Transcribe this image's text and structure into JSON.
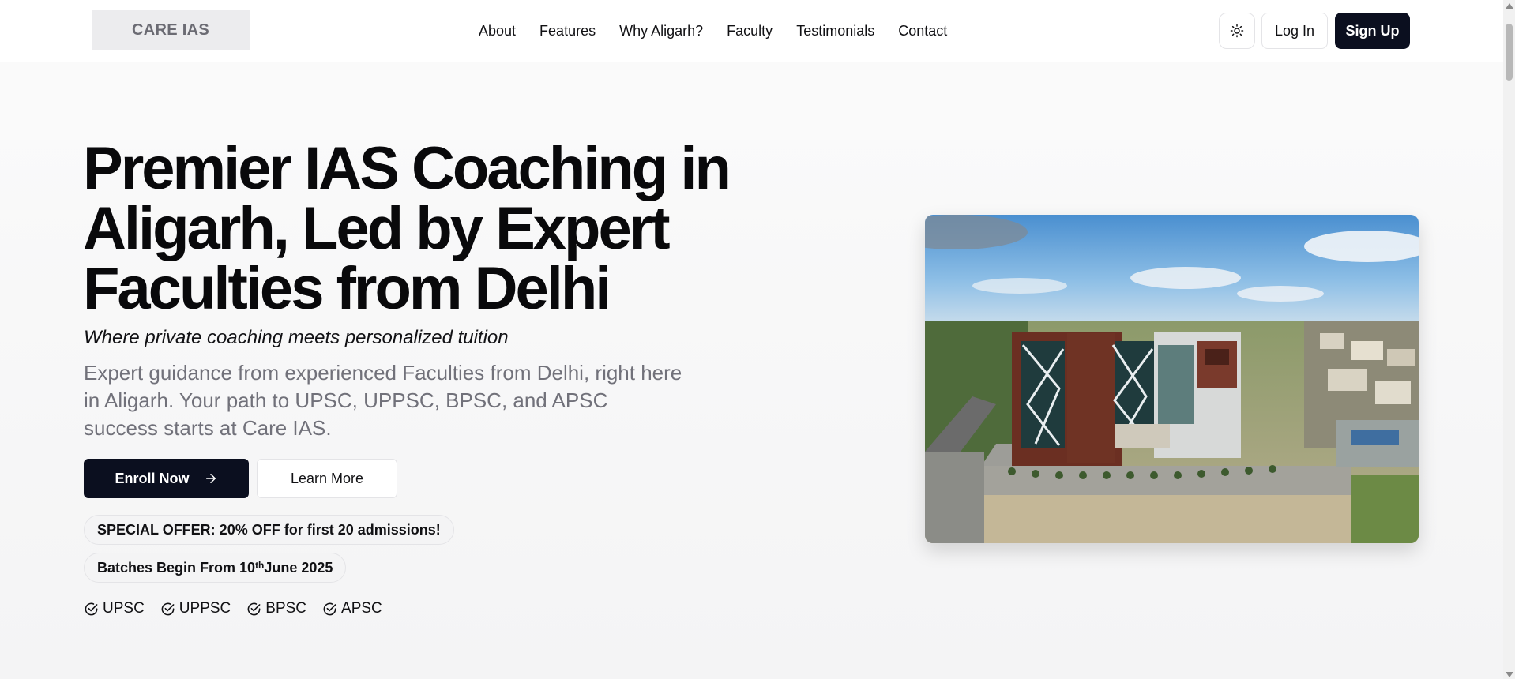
{
  "header": {
    "logo": "CARE IAS",
    "nav": [
      "About",
      "Features",
      "Why Aligarh?",
      "Faculty",
      "Testimonials",
      "Contact"
    ],
    "theme_toggle_icon": "sun-icon",
    "login_label": "Log In",
    "signup_label": "Sign Up"
  },
  "hero": {
    "headline": "Premier IAS Coaching in Aligarh, Led by Expert Faculties from Delhi",
    "tagline": "Where private coaching meets personalized tuition",
    "description": "Expert guidance from experienced Faculties from Delhi, right here in Aligarh. Your path to UPSC, UPPSC, BPSC, and APSC success starts at Care IAS.",
    "enroll_label": "Enroll Now",
    "learn_label": "Learn More",
    "offer_badge": "SPECIAL OFFER: 20% OFF for first 20 admissions!",
    "batch_prefix": "Batches Begin From 10",
    "batch_sup": "th",
    "batch_suffix": "June 2025",
    "exams": [
      "UPSC",
      "UPPSC",
      "BPSC",
      "APSC"
    ]
  },
  "colors": {
    "primary": "#0b0f1f",
    "muted_text": "#71717a",
    "border": "#e4e4e7"
  }
}
